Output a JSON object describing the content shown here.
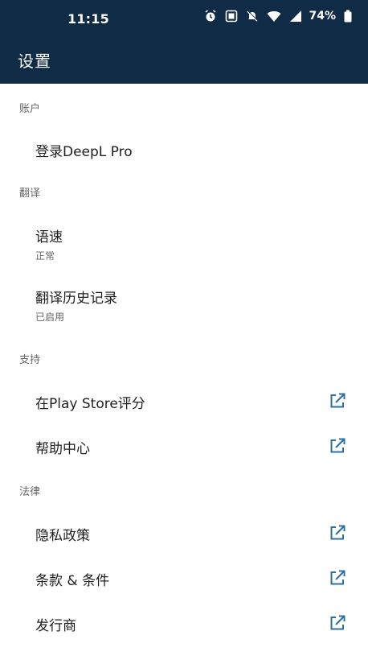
{
  "status_bar": {
    "time": "11:15",
    "battery": "74%"
  },
  "header": {
    "title": "设置"
  },
  "sections": {
    "account": {
      "header": "账户",
      "login": "登录DeepL Pro"
    },
    "translation": {
      "header": "翻译",
      "speech_rate": {
        "title": "语速",
        "value": "正常"
      },
      "history": {
        "title": "翻译历史记录",
        "value": "已启用"
      }
    },
    "support": {
      "header": "支持",
      "rate": "在Play Store评分",
      "help": "帮助中心"
    },
    "legal": {
      "header": "法律",
      "privacy": "隐私政策",
      "terms": "条款 & 条件",
      "publisher": "发行商"
    }
  },
  "icons": {
    "external_link": "external-link-icon",
    "alarm": "alarm-icon",
    "nfc": "nfc-icon",
    "mute": "mute-icon",
    "wifi": "wifi-icon",
    "signal": "signal-icon",
    "battery": "battery-icon"
  },
  "colors": {
    "header_bg": "#0f2b46",
    "accent": "#2e6fa0",
    "section_text": "#666666",
    "item_text": "#1f1f1f"
  }
}
